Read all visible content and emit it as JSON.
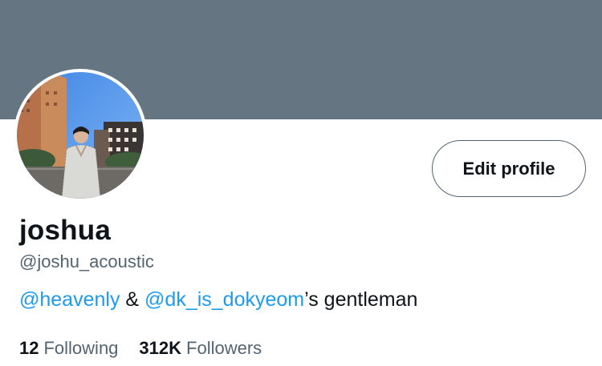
{
  "profile": {
    "banner_color": "#667582",
    "avatar_alt": "profile photo",
    "display_name": "joshua",
    "handle": "@joshu_acoustic",
    "edit_label": "Edit profile",
    "bio": {
      "mention1": "@heavenly",
      "amp": " & ",
      "mention2": "@dk_is_dokyeom",
      "suffix": "’s gentleman"
    },
    "stats": {
      "following_count": "12",
      "following_label": "Following",
      "followers_count": "312K",
      "followers_label": "Followers"
    }
  },
  "colors": {
    "link": "#1d9bf0",
    "text_primary": "#0f1419",
    "text_secondary": "#536471"
  }
}
